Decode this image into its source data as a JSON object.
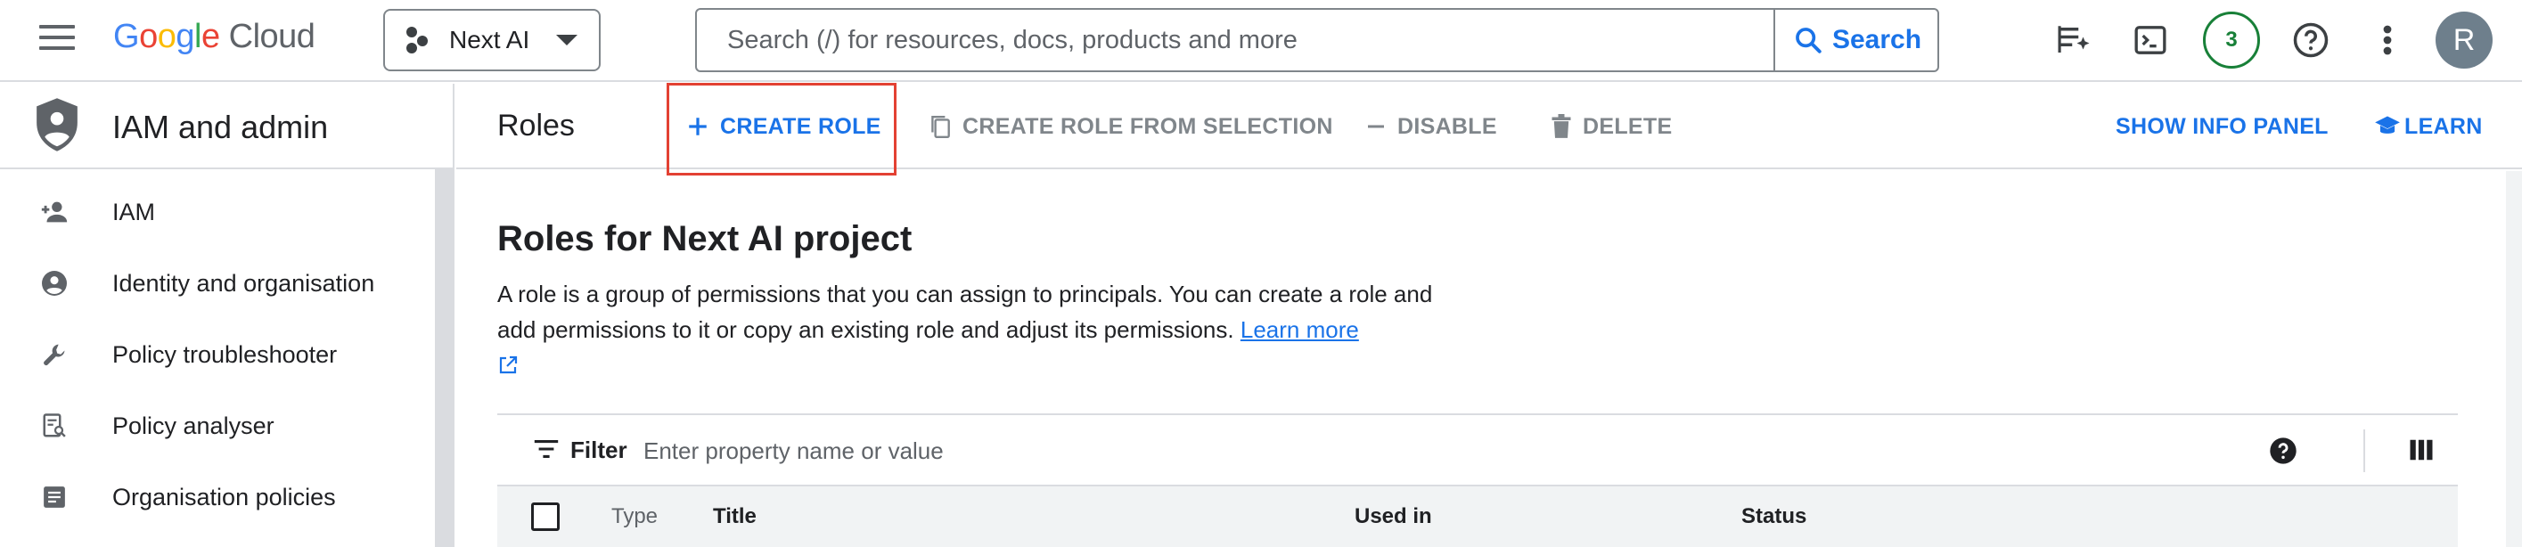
{
  "header": {
    "logo_google": "Google",
    "logo_cloud": "Cloud",
    "project_name": "Next AI",
    "search_placeholder": "Search (/) for resources, docs, products and more",
    "search_button": "Search",
    "notification_count": "3",
    "avatar_initial": "R",
    "icons": [
      "menu-icon",
      "gemini-icon",
      "cloud-shell-icon",
      "help-icon",
      "more-vert-icon"
    ]
  },
  "sidebar": {
    "title": "IAM and admin",
    "items": [
      {
        "label": "IAM",
        "icon": "person-add-icon"
      },
      {
        "label": "Identity and organisation",
        "icon": "account-circle-icon"
      },
      {
        "label": "Policy troubleshooter",
        "icon": "wrench-icon"
      },
      {
        "label": "Policy analyser",
        "icon": "analyser-icon"
      },
      {
        "label": "Organisation policies",
        "icon": "list-icon"
      }
    ]
  },
  "toolbar": {
    "page_title": "Roles",
    "create_role": "CREATE ROLE",
    "create_from_selection": "CREATE ROLE FROM SELECTION",
    "disable": "DISABLE",
    "delete": "DELETE",
    "show_info_panel": "SHOW INFO PANEL",
    "learn": "LEARN"
  },
  "main": {
    "heading": "Roles for Next AI project",
    "description": "A role is a group of permissions that you can assign to principals. You can create a role and add permissions to it or copy an existing role and adjust its permissions.",
    "learn_more": "Learn more",
    "filter_label": "Filter",
    "filter_placeholder": "Enter property name or value",
    "columns": [
      "Type",
      "Title",
      "Used in",
      "Status"
    ]
  },
  "colors": {
    "accent": "#1a73e8",
    "highlight_box": "#e34133",
    "badge": "#188038"
  }
}
